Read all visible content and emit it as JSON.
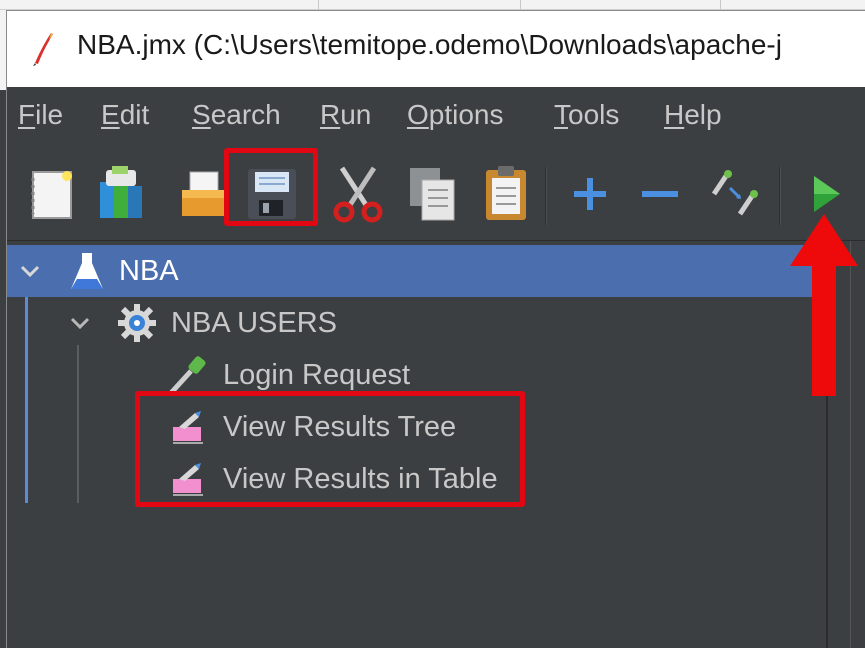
{
  "window": {
    "title": "NBA.jmx (C:\\Users\\temitope.odemo\\Downloads\\apache-j"
  },
  "menu": [
    {
      "label": "File",
      "mnemonic": "F"
    },
    {
      "label": "Edit",
      "mnemonic": "E"
    },
    {
      "label": "Search",
      "mnemonic": "S"
    },
    {
      "label": "Run",
      "mnemonic": "R"
    },
    {
      "label": "Options",
      "mnemonic": "O"
    },
    {
      "label": "Tools",
      "mnemonic": "T"
    },
    {
      "label": "Help",
      "mnemonic": "H"
    }
  ],
  "toolbar": {
    "buttons": [
      "new-icon",
      "templates-icon",
      "open-icon",
      "save-icon",
      "cut-icon",
      "copy-icon",
      "paste-icon",
      "expand-icon",
      "collapse-icon",
      "toggle-icon",
      "start-icon"
    ]
  },
  "tree": {
    "root": {
      "label": "NBA",
      "icon": "test-plan-icon"
    },
    "thread_group": {
      "label": "NBA USERS",
      "icon": "thread-group-icon"
    },
    "children": [
      {
        "label": "Login Request",
        "icon": "http-sampler-icon"
      },
      {
        "label": "View Results Tree",
        "icon": "listener-icon"
      },
      {
        "label": "View Results in Table",
        "icon": "listener-icon"
      }
    ]
  },
  "colors": {
    "selection": "#4b6eaf",
    "annotation": "#e30613",
    "background": "#3c3f41"
  }
}
